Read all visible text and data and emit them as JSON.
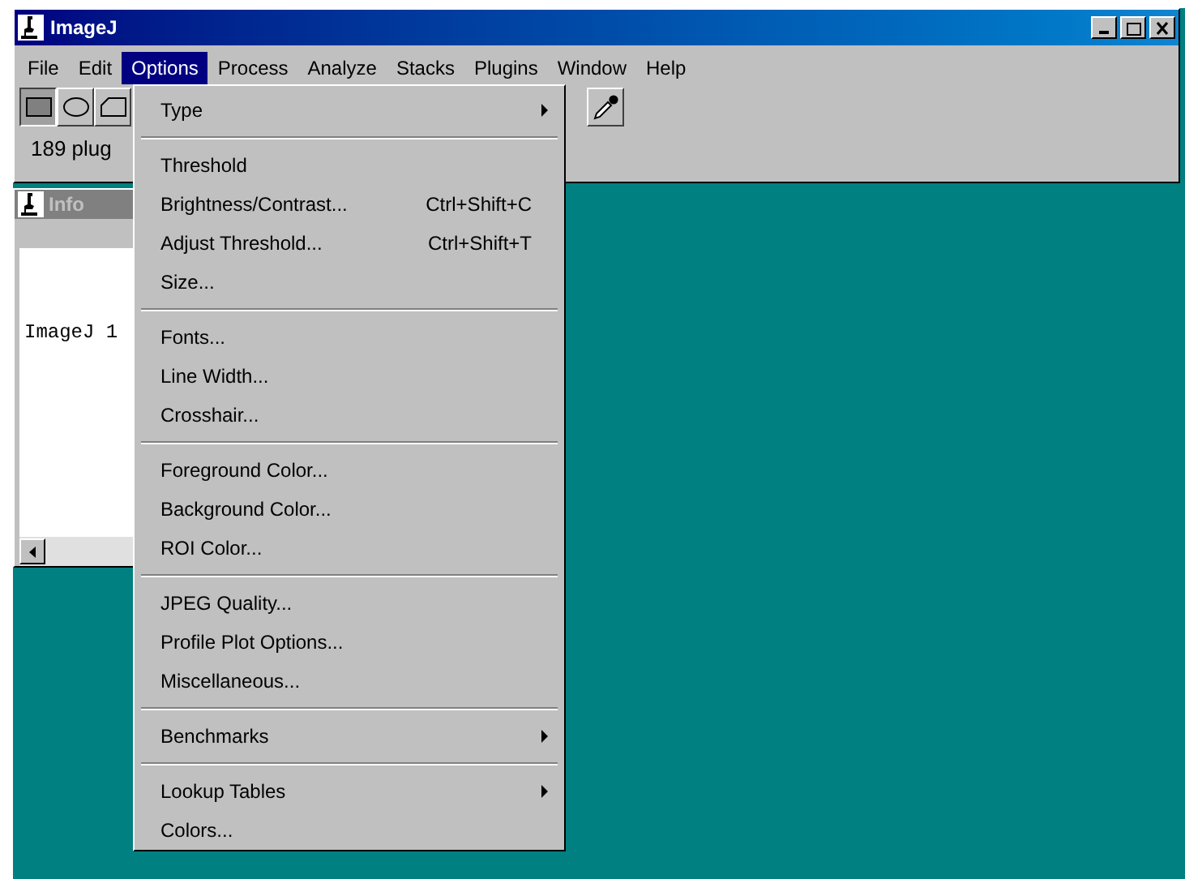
{
  "window": {
    "title": "ImageJ"
  },
  "menubar": [
    {
      "label": "File",
      "selected": false
    },
    {
      "label": "Edit",
      "selected": false
    },
    {
      "label": "Options",
      "selected": true
    },
    {
      "label": "Process",
      "selected": false
    },
    {
      "label": "Analyze",
      "selected": false
    },
    {
      "label": "Stacks",
      "selected": false
    },
    {
      "label": "Plugins",
      "selected": false
    },
    {
      "label": "Window",
      "selected": false
    },
    {
      "label": "Help",
      "selected": false
    }
  ],
  "toolbar": [
    {
      "kind": "rectangle",
      "selected": true
    },
    {
      "kind": "oval",
      "selected": false
    },
    {
      "kind": "polygon",
      "selected": false
    },
    {
      "kind": "eyedropper",
      "selected": false
    }
  ],
  "status": "189 plug",
  "info_window": {
    "title": "Info",
    "text": "ImageJ 1"
  },
  "menu": [
    {
      "kind": "item",
      "label": "Type",
      "submenu": true
    },
    {
      "kind": "separator"
    },
    {
      "kind": "item",
      "label": "Threshold",
      "submenu": false
    },
    {
      "kind": "item",
      "label": "Brightness/Contrast...",
      "shortcut": "Ctrl+Shift+C",
      "submenu": false
    },
    {
      "kind": "item",
      "label": "Adjust Threshold...",
      "shortcut": "Ctrl+Shift+T",
      "submenu": false
    },
    {
      "kind": "item",
      "label": "Size...",
      "submenu": false
    },
    {
      "kind": "separator"
    },
    {
      "kind": "item",
      "label": "Fonts...",
      "submenu": false
    },
    {
      "kind": "item",
      "label": "Line Width...",
      "submenu": false
    },
    {
      "kind": "item",
      "label": "Crosshair...",
      "submenu": false
    },
    {
      "kind": "separator"
    },
    {
      "kind": "item",
      "label": "Foreground Color...",
      "submenu": false
    },
    {
      "kind": "item",
      "label": "Background Color...",
      "submenu": false
    },
    {
      "kind": "item",
      "label": "ROI Color...",
      "submenu": false
    },
    {
      "kind": "separator"
    },
    {
      "kind": "item",
      "label": "JPEG Quality...",
      "submenu": false
    },
    {
      "kind": "item",
      "label": "Profile Plot Options...",
      "submenu": false
    },
    {
      "kind": "item",
      "label": "Miscellaneous...",
      "submenu": false
    },
    {
      "kind": "separator"
    },
    {
      "kind": "item",
      "label": "Benchmarks",
      "submenu": true
    },
    {
      "kind": "separator"
    },
    {
      "kind": "item",
      "label": "Lookup Tables",
      "submenu": true
    },
    {
      "kind": "item",
      "label": "Colors...",
      "submenu": false
    }
  ]
}
